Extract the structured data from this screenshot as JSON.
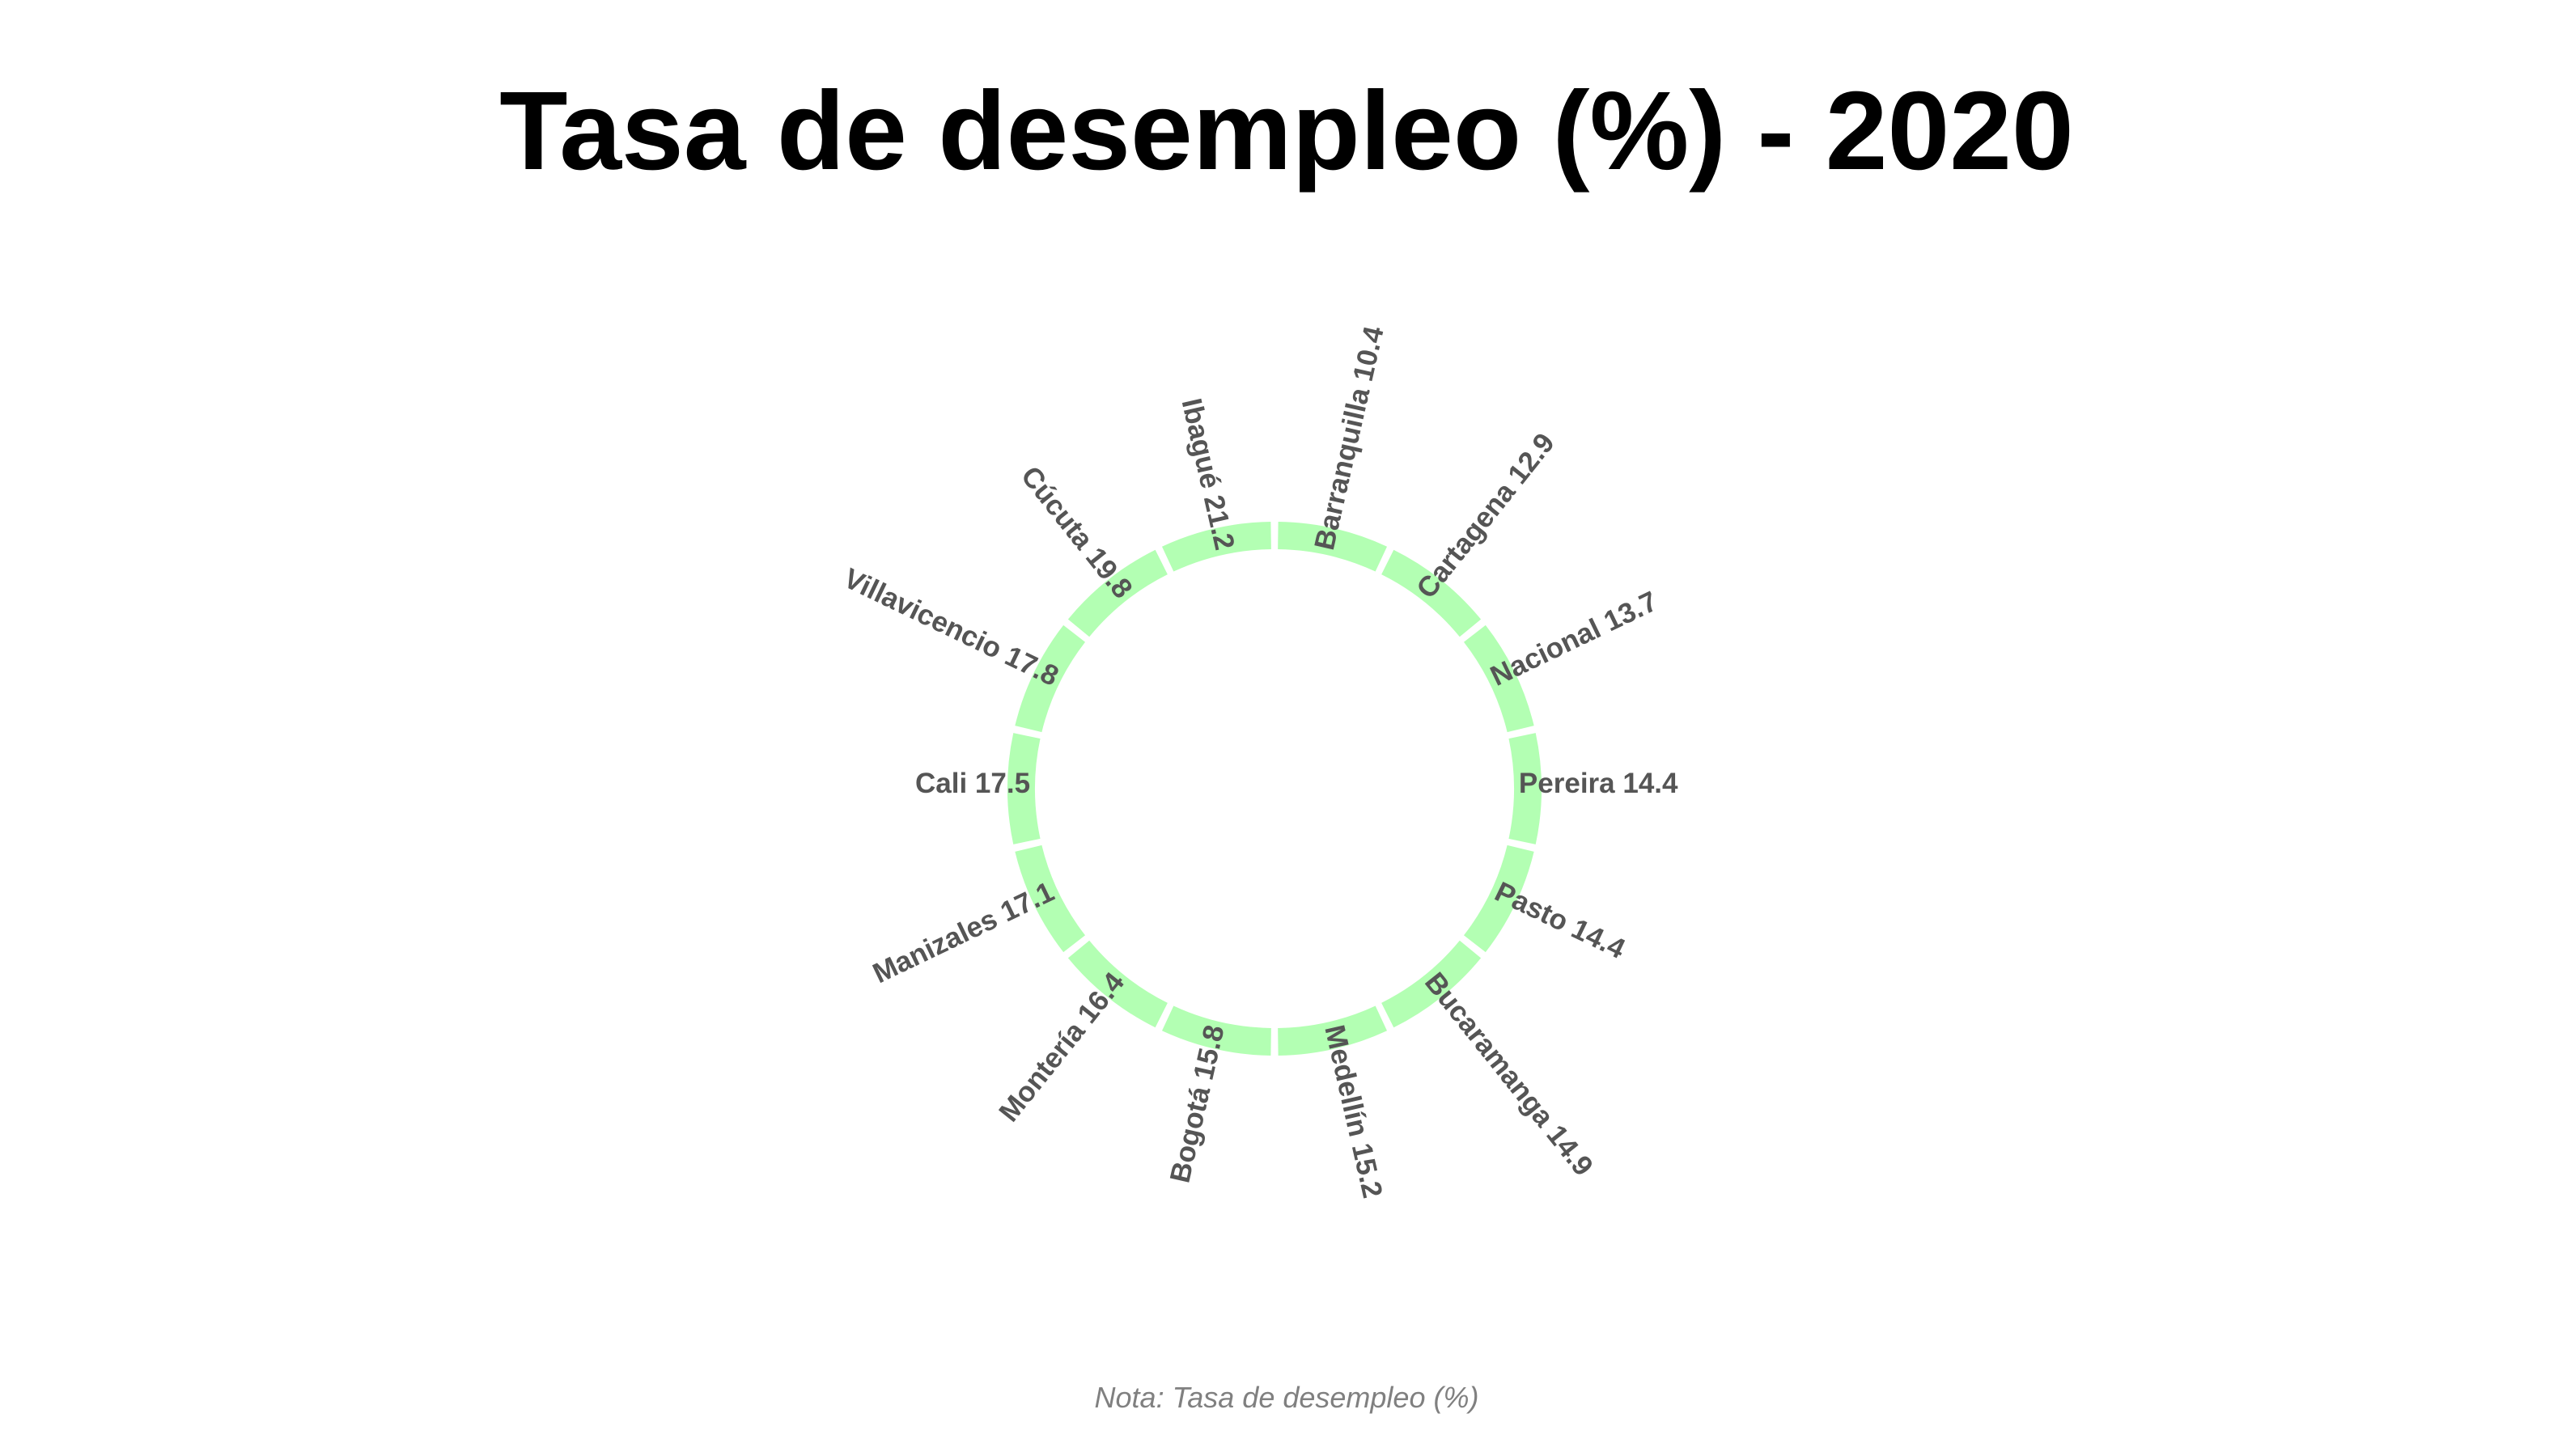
{
  "chart_data": {
    "type": "bar",
    "layout": "circular",
    "title": "Tasa de desempleo (%) - 2020",
    "note": "Nota: Tasa de desempleo (%)",
    "bar_color": "#b3ffb3",
    "label_color": "#555555",
    "categories": [
      "Barranquilla",
      "Cartagena",
      "Nacional",
      "Pereira",
      "Pasto",
      "Bucaramanga",
      "Medellín",
      "Bogotá",
      "Montería",
      "Manizales",
      "Cali",
      "Villavicencio",
      "Cúcuta",
      "Ibagué"
    ],
    "values": [
      10.4,
      12.9,
      13.7,
      14.4,
      14.4,
      14.9,
      15.2,
      15.8,
      16.4,
      17.1,
      17.5,
      17.8,
      19.8,
      21.2
    ],
    "labels": [
      "Barranquilla 10.4",
      "Cartagena 12.9",
      "Nacional 13.7",
      "Pereira 14.4",
      "Pasto 14.4",
      "Bucaramanga 14.9",
      "Medellín 15.2",
      "Bogotá 15.8",
      "Montería 16.4",
      "Manizales 17.1",
      "Cali 17.5",
      "Villavicencio 17.8",
      "Cúcuta 19.8",
      "Ibagué 21.2"
    ]
  }
}
